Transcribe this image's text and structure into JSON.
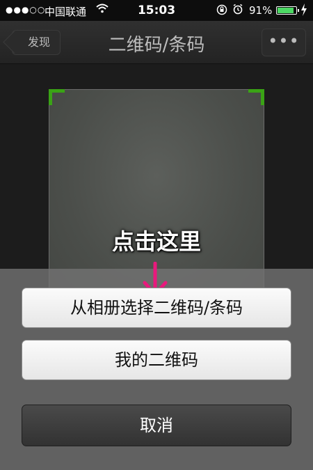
{
  "status_bar": {
    "signal": "●●●○○",
    "carrier": "中国联通",
    "time": "15:03",
    "battery": "91%",
    "battery_level": 0.91,
    "icons": [
      "wifi-icon",
      "rotation-lock-icon",
      "alarm-icon",
      "battery-icon",
      "charging-icon"
    ],
    "battery_color": "#4cd964"
  },
  "nav_bar": {
    "back_label": "发现",
    "title": "二维码/条码",
    "more_label": "•••"
  },
  "annotation": {
    "text": "点击这里",
    "arrow_color": "#e8197d"
  },
  "action_sheet": {
    "album_label": "从相册选择二维码/条码",
    "my_qr_label": "我的二维码",
    "cancel_label": "取消"
  },
  "colors": {
    "scan_corner": "#3aa315"
  }
}
